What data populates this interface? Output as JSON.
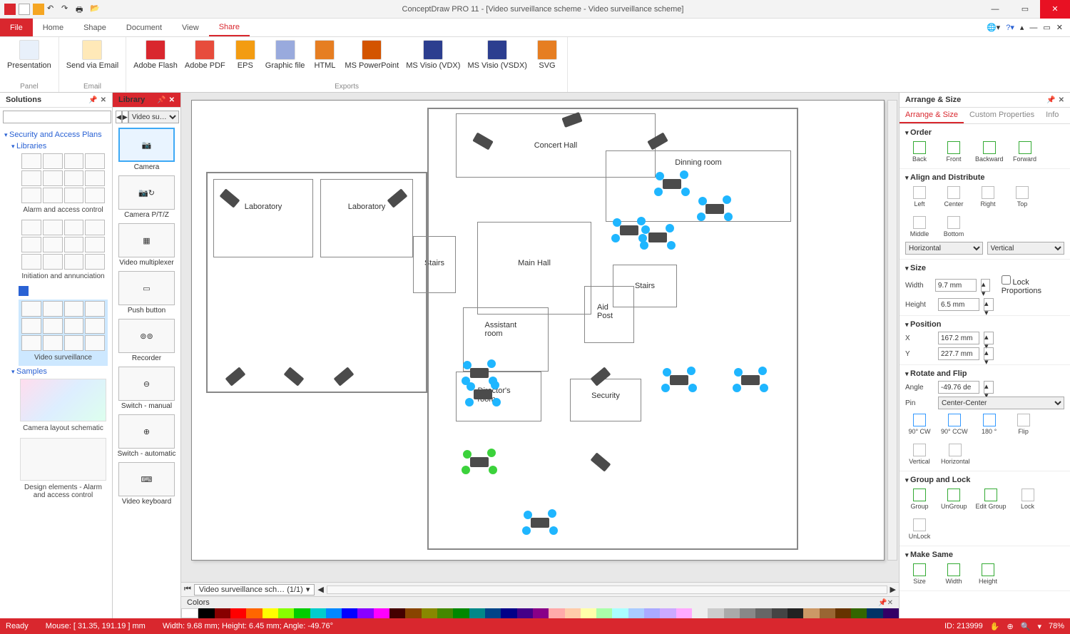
{
  "app": {
    "title": "ConceptDraw PRO 11 - [Video surveillance scheme - Video surveillance scheme]"
  },
  "menu": {
    "file": "File",
    "tabs": [
      "Home",
      "Shape",
      "Document",
      "View",
      "Share"
    ],
    "active": "Share"
  },
  "ribbon": {
    "groups": [
      {
        "label": "Panel",
        "items": [
          {
            "label": "Presentation"
          }
        ]
      },
      {
        "label": "Email",
        "items": [
          {
            "label": "Send via Email"
          }
        ]
      },
      {
        "label": "Exports",
        "items": [
          {
            "label": "Adobe Flash"
          },
          {
            "label": "Adobe PDF"
          },
          {
            "label": "EPS"
          },
          {
            "label": "Graphic file"
          },
          {
            "label": "HTML"
          },
          {
            "label": "MS PowerPoint"
          },
          {
            "label": "MS Visio (VDX)"
          },
          {
            "label": "MS Visio (VSDX)"
          },
          {
            "label": "SVG"
          }
        ]
      }
    ]
  },
  "solutions": {
    "title": "Solutions",
    "root": "Security and Access Plans",
    "libraries_hdr": "Libraries",
    "libs": [
      "Alarm and access control",
      "Initiation and annunciation",
      "Video surveillance"
    ],
    "samples_hdr": "Samples",
    "samples": [
      "Camera layout schematic",
      "Design elements - Alarm and access control"
    ]
  },
  "library": {
    "title": "Library",
    "selector": "Video su…",
    "items": [
      {
        "label": "Camera",
        "sel": true
      },
      {
        "label": "Camera P/T/Z"
      },
      {
        "label": "Video multiplexer"
      },
      {
        "label": "Push button"
      },
      {
        "label": "Recorder"
      },
      {
        "label": "Switch - manual"
      },
      {
        "label": "Switch - automatic"
      },
      {
        "label": "Video keyboard"
      }
    ]
  },
  "canvas": {
    "rooms": [
      "Concert Hall",
      "Dinning room",
      "Laboratory",
      "Laboratory",
      "Stairs",
      "Main Hall",
      "Assistant room",
      "Aid Post",
      "Stairs",
      "Director's room",
      "Security"
    ],
    "doctab": "Video surveillance sch…  (1/1)"
  },
  "colors": {
    "title": "Colors"
  },
  "arrange": {
    "title": "Arrange & Size",
    "tabs": [
      "Arrange & Size",
      "Custom Properties",
      "Info"
    ],
    "order": {
      "hdr": "Order",
      "btns": [
        "Back",
        "Front",
        "Backward",
        "Forward"
      ]
    },
    "align": {
      "hdr": "Align and Distribute",
      "btns": [
        "Left",
        "Center",
        "Right",
        "Top",
        "Middle",
        "Bottom"
      ],
      "h": "Horizontal",
      "v": "Vertical"
    },
    "size": {
      "hdr": "Size",
      "w_lbl": "Width",
      "w": "9.7 mm",
      "h_lbl": "Height",
      "h": "6.5 mm",
      "lock": "Lock Proportions"
    },
    "position": {
      "hdr": "Position",
      "x_lbl": "X",
      "x": "167.2 mm",
      "y_lbl": "Y",
      "y": "227.7 mm"
    },
    "rotate": {
      "hdr": "Rotate and Flip",
      "a_lbl": "Angle",
      "a": "-49.76 de",
      "p_lbl": "Pin",
      "p": "Center-Center",
      "btns": [
        "90° CW",
        "90° CCW",
        "180 °",
        "Flip",
        "Vertical",
        "Horizontal"
      ]
    },
    "group": {
      "hdr": "Group and Lock",
      "btns": [
        "Group",
        "UnGroup",
        "Edit Group",
        "Lock",
        "UnLock"
      ]
    },
    "same": {
      "hdr": "Make Same",
      "btns": [
        "Size",
        "Width",
        "Height"
      ]
    }
  },
  "status": {
    "ready": "Ready",
    "mouse": "Mouse: [ 31.35, 191.19 ]  mm",
    "dims": "Width: 9.68 mm;   Height: 6.45 mm;   Angle: -49.76°",
    "id": "ID: 213999",
    "zoom": "78%"
  }
}
